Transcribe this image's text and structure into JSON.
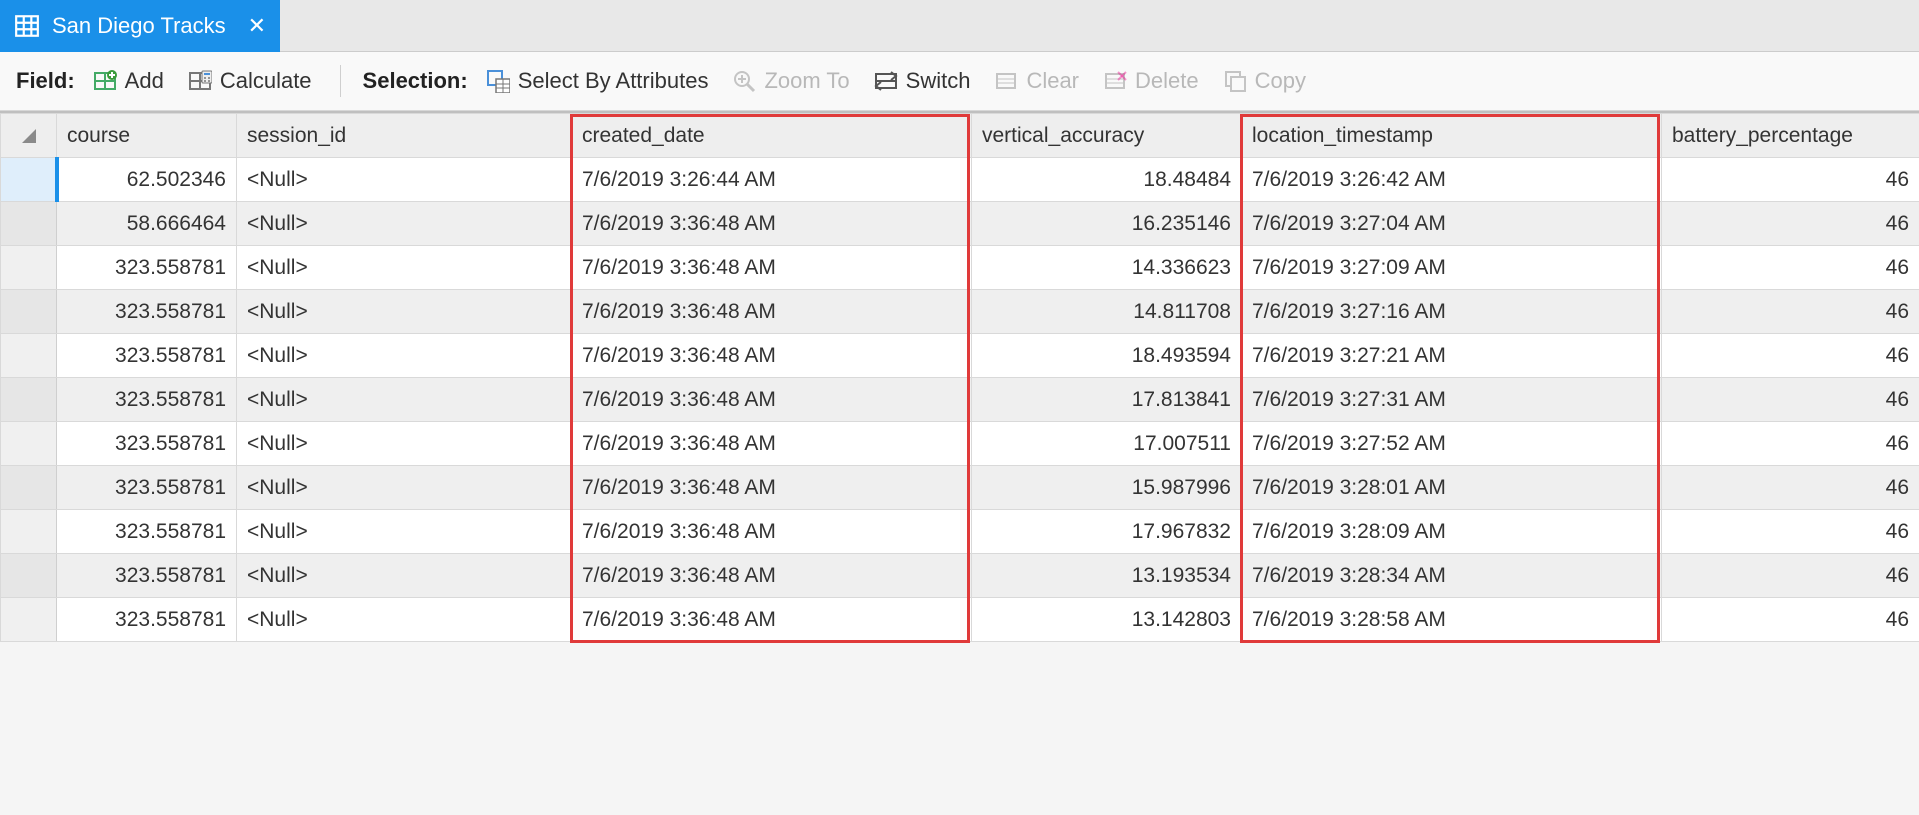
{
  "tab": {
    "title": "San Diego Tracks"
  },
  "toolbar": {
    "field_label": "Field:",
    "add": "Add",
    "calculate": "Calculate",
    "selection_label": "Selection:",
    "select_by_attr": "Select By Attributes",
    "zoom_to": "Zoom To",
    "switch": "Switch",
    "clear": "Clear",
    "delete": "Delete",
    "copy": "Copy"
  },
  "columns": {
    "course": "course",
    "session_id": "session_id",
    "created_date": "created_date",
    "vertical_accuracy": "vertical_accuracy",
    "location_timestamp": "location_timestamp",
    "battery_percentage": "battery_percentage"
  },
  "rows": [
    {
      "course": "62.502346",
      "session_id": "<Null>",
      "created_date": "7/6/2019 3:26:44 AM",
      "vertical_accuracy": "18.48484",
      "location_timestamp": "7/6/2019 3:26:42 AM",
      "battery_percentage": "46",
      "selected": true
    },
    {
      "course": "58.666464",
      "session_id": "<Null>",
      "created_date": "7/6/2019 3:36:48 AM",
      "vertical_accuracy": "16.235146",
      "location_timestamp": "7/6/2019 3:27:04 AM",
      "battery_percentage": "46"
    },
    {
      "course": "323.558781",
      "session_id": "<Null>",
      "created_date": "7/6/2019 3:36:48 AM",
      "vertical_accuracy": "14.336623",
      "location_timestamp": "7/6/2019 3:27:09 AM",
      "battery_percentage": "46"
    },
    {
      "course": "323.558781",
      "session_id": "<Null>",
      "created_date": "7/6/2019 3:36:48 AM",
      "vertical_accuracy": "14.811708",
      "location_timestamp": "7/6/2019 3:27:16 AM",
      "battery_percentage": "46"
    },
    {
      "course": "323.558781",
      "session_id": "<Null>",
      "created_date": "7/6/2019 3:36:48 AM",
      "vertical_accuracy": "18.493594",
      "location_timestamp": "7/6/2019 3:27:21 AM",
      "battery_percentage": "46"
    },
    {
      "course": "323.558781",
      "session_id": "<Null>",
      "created_date": "7/6/2019 3:36:48 AM",
      "vertical_accuracy": "17.813841",
      "location_timestamp": "7/6/2019 3:27:31 AM",
      "battery_percentage": "46"
    },
    {
      "course": "323.558781",
      "session_id": "<Null>",
      "created_date": "7/6/2019 3:36:48 AM",
      "vertical_accuracy": "17.007511",
      "location_timestamp": "7/6/2019 3:27:52 AM",
      "battery_percentage": "46"
    },
    {
      "course": "323.558781",
      "session_id": "<Null>",
      "created_date": "7/6/2019 3:36:48 AM",
      "vertical_accuracy": "15.987996",
      "location_timestamp": "7/6/2019 3:28:01 AM",
      "battery_percentage": "46"
    },
    {
      "course": "323.558781",
      "session_id": "<Null>",
      "created_date": "7/6/2019 3:36:48 AM",
      "vertical_accuracy": "17.967832",
      "location_timestamp": "7/6/2019 3:28:09 AM",
      "battery_percentage": "46"
    },
    {
      "course": "323.558781",
      "session_id": "<Null>",
      "created_date": "7/6/2019 3:36:48 AM",
      "vertical_accuracy": "13.193534",
      "location_timestamp": "7/6/2019 3:28:34 AM",
      "battery_percentage": "46"
    },
    {
      "course": "323.558781",
      "session_id": "<Null>",
      "created_date": "7/6/2019 3:36:48 AM",
      "vertical_accuracy": "13.142803",
      "location_timestamp": "7/6/2019 3:28:58 AM",
      "battery_percentage": "46"
    }
  ]
}
